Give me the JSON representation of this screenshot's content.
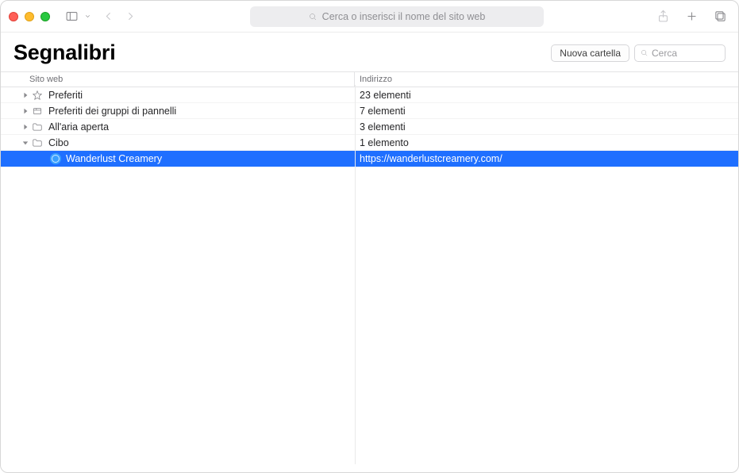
{
  "toolbar": {
    "address_placeholder": "Cerca o inserisci il nome del sito web"
  },
  "header": {
    "title": "Segnalibri",
    "new_folder_label": "Nuova cartella",
    "search_placeholder": "Cerca"
  },
  "columns": {
    "name": "Sito web",
    "address": "Indirizzo"
  },
  "rows": [
    {
      "depth": 0,
      "expanded": false,
      "icon": "star",
      "name": "Preferiti",
      "address": "23 elementi",
      "selected": false
    },
    {
      "depth": 0,
      "expanded": false,
      "icon": "tabgroup",
      "name": "Preferiti dei gruppi di pannelli",
      "address": "7 elementi",
      "selected": false
    },
    {
      "depth": 0,
      "expanded": false,
      "icon": "folder",
      "name": "All'aria aperta",
      "address": "3 elementi",
      "selected": false
    },
    {
      "depth": 0,
      "expanded": true,
      "icon": "folder",
      "name": "Cibo",
      "address": "1 elemento",
      "selected": false
    },
    {
      "depth": 1,
      "expanded": null,
      "icon": "globe",
      "name": "Wanderlust Creamery",
      "address": "https://wanderlustcreamery.com/",
      "selected": true
    }
  ]
}
